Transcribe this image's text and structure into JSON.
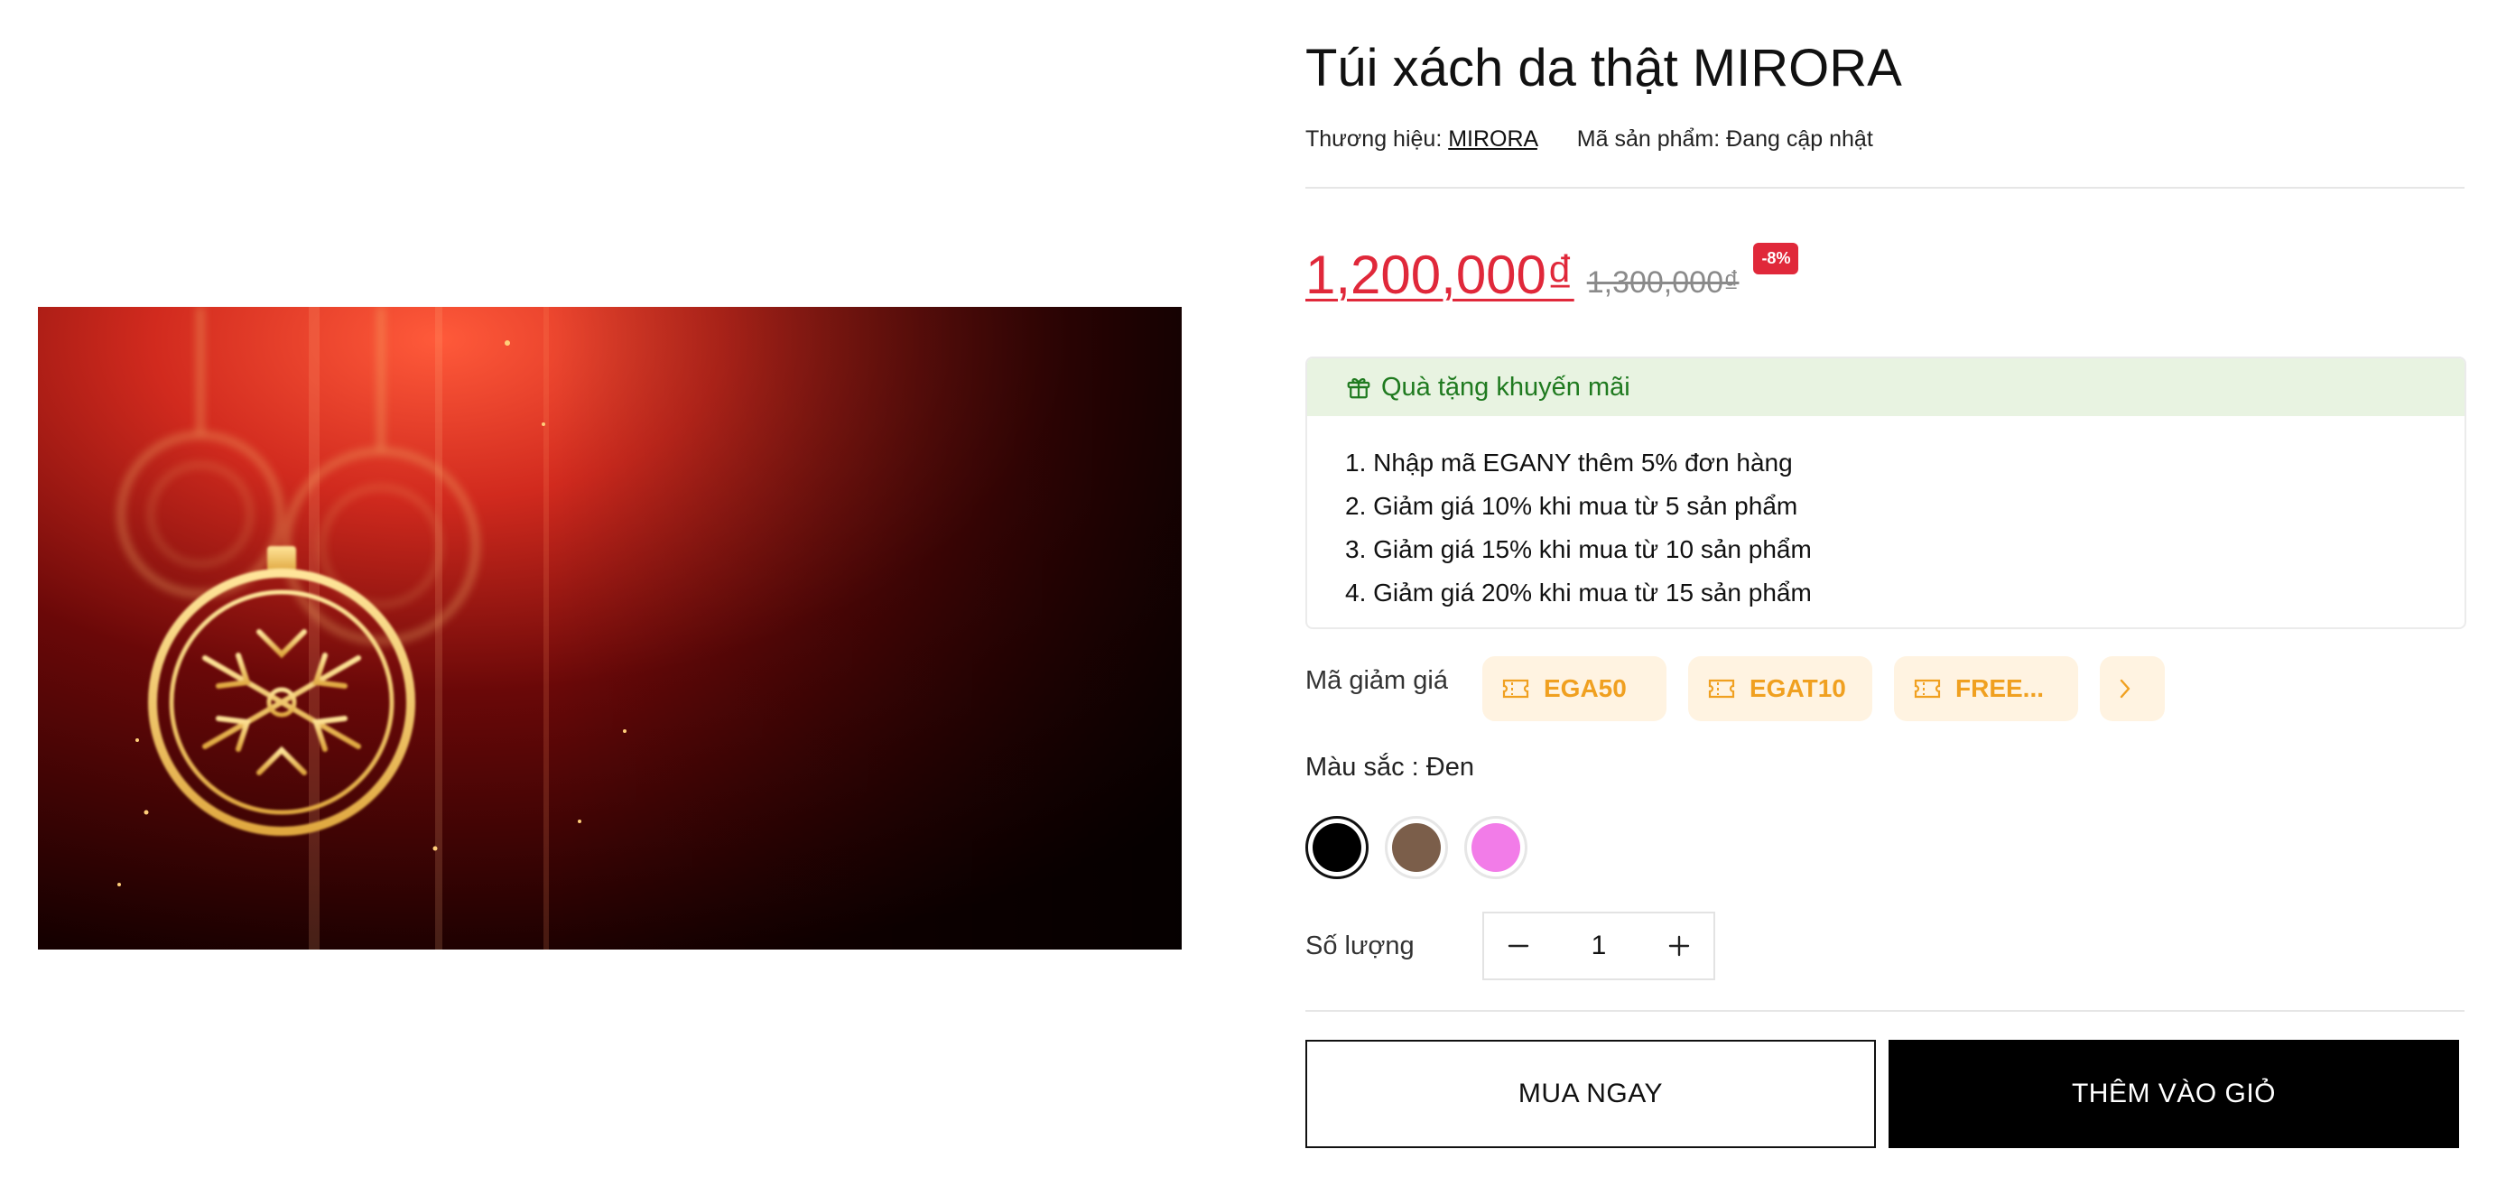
{
  "product": {
    "title": "Túi xách da thật MIRORA",
    "brand_label": "Thương hiệu:",
    "brand": "MIRORA",
    "sku_label": "Mã sản phẩm:",
    "sku": "Đang cập nhật"
  },
  "pricing": {
    "price": "1,200,000₫",
    "compare_price": "1,300,000₫",
    "discount_badge": "-8%",
    "price_color": "#e0283a"
  },
  "promotion": {
    "title": "Quà tặng khuyến mãi",
    "icon": "gift-icon",
    "items": [
      "1. Nhập mã EGANY thêm 5% đơn hàng",
      "2. Giảm giá 10% khi mua từ 5 sản phẩm",
      "3. Giảm giá 15% khi mua từ 10 sản phẩm",
      "4. Giảm giá 20% khi mua từ 15 sản phẩm"
    ]
  },
  "coupons": {
    "label": "Mã giảm giá",
    "codes": [
      "EGA50",
      "EGAT10",
      "FREE..."
    ],
    "icon": "ticket-icon",
    "more_icon": "chevron-right-icon",
    "accent": "#f0a020"
  },
  "color": {
    "label": "Màu sắc : Đen",
    "swatches": [
      {
        "name": "black",
        "hex": "#000000",
        "selected": true
      },
      {
        "name": "brown",
        "hex": "#7b5e4a",
        "selected": false
      },
      {
        "name": "pink",
        "hex": "#f27ce8",
        "selected": false
      }
    ]
  },
  "quantity": {
    "label": "Số lượng",
    "value": "1",
    "minus_icon": "minus-icon",
    "plus_icon": "plus-icon"
  },
  "actions": {
    "buy_now": "MUA NGAY",
    "add_to_cart": "THÊM VÀO GIỎ"
  },
  "gallery": {
    "image": "christmas-ornaments-image"
  }
}
